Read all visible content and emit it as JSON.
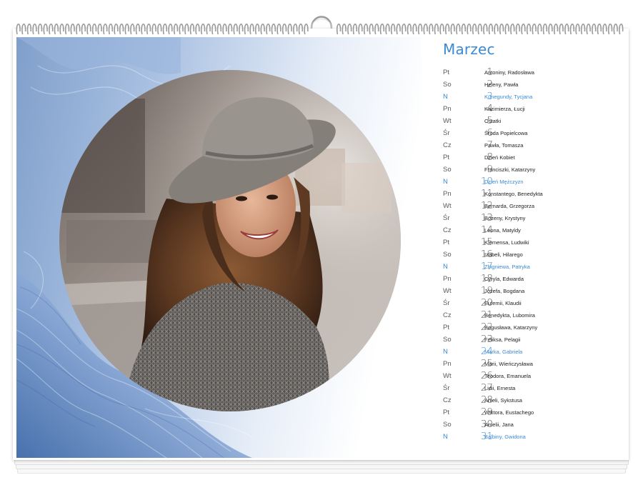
{
  "calendar": {
    "month": "Marzec",
    "accent_color": "#3b8ad3",
    "days": [
      {
        "dow": "Pt",
        "num": "1",
        "names": "Antoniny, Radosława",
        "sunday": false
      },
      {
        "dow": "So",
        "num": "2",
        "names": "Heleny, Pawła",
        "sunday": false
      },
      {
        "dow": "N",
        "num": "3",
        "names": "Kunegundy, Tycjana",
        "sunday": true
      },
      {
        "dow": "Pn",
        "num": "4",
        "names": "Kazimierza, Łucji",
        "sunday": false
      },
      {
        "dow": "Wt",
        "num": "5",
        "names": "Ostatki",
        "sunday": false
      },
      {
        "dow": "Śr",
        "num": "6",
        "names": "Środa Popielcowa",
        "sunday": false
      },
      {
        "dow": "Cz",
        "num": "7",
        "names": "Pawła, Tomasza",
        "sunday": false
      },
      {
        "dow": "Pt",
        "num": "8",
        "names": "Dzień Kobiet",
        "sunday": false
      },
      {
        "dow": "So",
        "num": "9",
        "names": "Franciszki, Katarzyny",
        "sunday": false
      },
      {
        "dow": "N",
        "num": "10",
        "names": "Dzień Mężczyzn",
        "sunday": true
      },
      {
        "dow": "Pn",
        "num": "11",
        "names": "Konstantego, Benedykta",
        "sunday": false
      },
      {
        "dow": "Wt",
        "num": "12",
        "names": "Bernarda, Grzegorza",
        "sunday": false
      },
      {
        "dow": "Śr",
        "num": "13",
        "names": "Bożeny, Krystyny",
        "sunday": false
      },
      {
        "dow": "Cz",
        "num": "14",
        "names": "Leona, Matyldy",
        "sunday": false
      },
      {
        "dow": "Pt",
        "num": "15",
        "names": "Klemensa, Ludwiki",
        "sunday": false
      },
      {
        "dow": "So",
        "num": "16",
        "names": "Izabeli, Hilarego",
        "sunday": false
      },
      {
        "dow": "N",
        "num": "17",
        "names": "Zbigniewa, Patryka",
        "sunday": true
      },
      {
        "dow": "Pn",
        "num": "18",
        "names": "Cyryla, Edwarda",
        "sunday": false
      },
      {
        "dow": "Wt",
        "num": "19",
        "names": "Józefa, Bogdana",
        "sunday": false
      },
      {
        "dow": "Śr",
        "num": "20",
        "names": "Eufemii, Klaudii",
        "sunday": false
      },
      {
        "dow": "Cz",
        "num": "21",
        "names": "Benedykta, Lubomira",
        "sunday": false
      },
      {
        "dow": "Pt",
        "num": "22",
        "names": "Bogusława, Katarzyny",
        "sunday": false
      },
      {
        "dow": "So",
        "num": "23",
        "names": "Feliksa, Pelagii",
        "sunday": false
      },
      {
        "dow": "N",
        "num": "24",
        "names": "Marka, Gabriela",
        "sunday": true
      },
      {
        "dow": "Pn",
        "num": "25",
        "names": "Marii, Wieńczysława",
        "sunday": false
      },
      {
        "dow": "Wt",
        "num": "26",
        "names": "Teodora, Emanuela",
        "sunday": false
      },
      {
        "dow": "Śr",
        "num": "27",
        "names": "Lidii, Ernesta",
        "sunday": false
      },
      {
        "dow": "Cz",
        "num": "28",
        "names": "Anieli, Sykstusa",
        "sunday": false
      },
      {
        "dow": "Pt",
        "num": "29",
        "names": "Wiktora, Eustachego",
        "sunday": false
      },
      {
        "dow": "So",
        "num": "30",
        "names": "Amelii, Jana",
        "sunday": false
      },
      {
        "dow": "N",
        "num": "31",
        "names": "Balbiny, Gwidona",
        "sunday": true
      }
    ]
  },
  "photo": {
    "subject": "woman-in-hat-photo",
    "background_icon": "blue-marble-pattern"
  }
}
